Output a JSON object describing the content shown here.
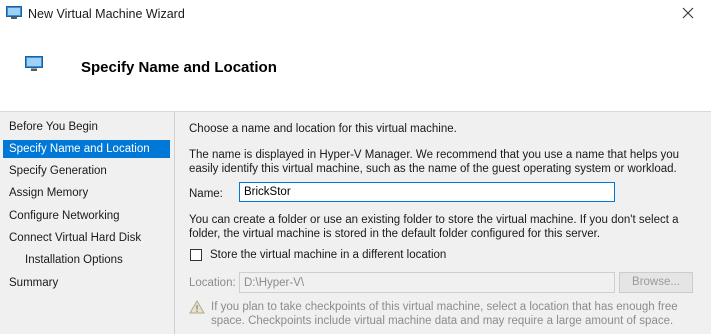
{
  "window": {
    "title": "New Virtual Machine Wizard",
    "icon": "monitor-icon",
    "close_icon": "close-icon"
  },
  "header": {
    "title": "Specify Name and Location",
    "icon": "monitor-icon"
  },
  "sidebar": {
    "items": [
      {
        "label": "Before You Begin",
        "active": false
      },
      {
        "label": "Specify Name and Location",
        "active": true
      },
      {
        "label": "Specify Generation",
        "active": false
      },
      {
        "label": "Assign Memory",
        "active": false
      },
      {
        "label": "Configure Networking",
        "active": false
      },
      {
        "label": "Connect Virtual Hard Disk",
        "active": false
      },
      {
        "label": "Installation Options",
        "active": false,
        "sub": true
      },
      {
        "label": "Summary",
        "active": false
      }
    ]
  },
  "main": {
    "intro": "Choose a name and location for this virtual machine.",
    "name_help": "The name is displayed in Hyper-V Manager. We recommend that you use a name that helps you easily identify this virtual machine, such as the name of the guest operating system or workload.",
    "name_label": "Name:",
    "name_value": "BrickStor",
    "folder_help": "You can create a folder or use an existing folder to store the virtual machine. If you don't select a folder, the virtual machine is stored in the default folder configured for this server.",
    "checkbox_label": "Store the virtual machine in a different location",
    "checkbox_checked": false,
    "location_label": "Location:",
    "location_value": "D:\\Hyper-V\\",
    "browse_label": "Browse...",
    "warning_icon": "warning-icon",
    "warning_text": "If you plan to take checkpoints of this virtual machine, select a location that has enough free space. Checkpoints include virtual machine data and may require a large amount of space."
  },
  "colors": {
    "accent": "#0078d7",
    "panel_bg": "#f0f0f0",
    "disabled_text": "#8c8c8c"
  }
}
